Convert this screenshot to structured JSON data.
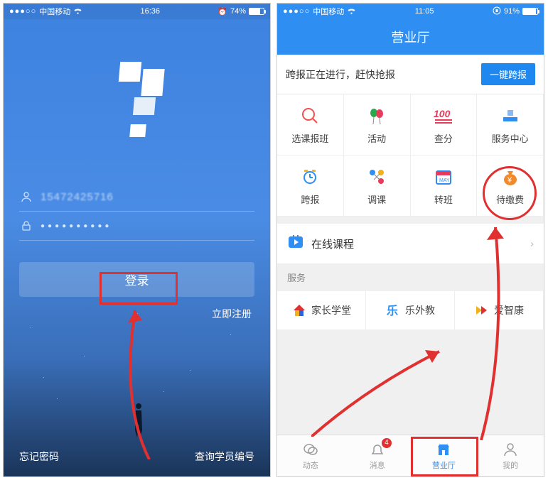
{
  "left": {
    "statusbar": {
      "signal": "●●●○○",
      "carrier": "中国移动",
      "time": "16:36",
      "battery_alarm": "⏰",
      "battery_pct": "74%"
    },
    "username_value": "15472425716",
    "password_masked": "●●●●●●●●●●",
    "login_label": "登录",
    "register_label": "立即注册",
    "forgot_label": "忘记密码",
    "lookup_label": "查询学员编号"
  },
  "right": {
    "statusbar": {
      "signal": "●●●○○",
      "carrier": "中国移动",
      "time": "11:05",
      "lock": true,
      "battery_pct": "91%"
    },
    "header_title": "营业厅",
    "notice_text": "跨报正在进行，赶快抢报",
    "notice_btn": "一键跨报",
    "grid": [
      {
        "label": "选课报班",
        "icon": "#f05050",
        "shape": "magnify"
      },
      {
        "label": "活动",
        "icon": "#2aa84a",
        "shape": "balloons"
      },
      {
        "label": "查分",
        "icon": "#e83a5a",
        "shape": "score100"
      },
      {
        "label": "服务中心",
        "icon": "#2e8ef2",
        "shape": "desk"
      },
      {
        "label": "跨报",
        "icon": "#2e8ef2",
        "shape": "clock"
      },
      {
        "label": "调课",
        "icon": "#f09a2a",
        "shape": "swap"
      },
      {
        "label": "转班",
        "icon": "#2e8ef2",
        "shape": "calendar"
      },
      {
        "label": "待缴费",
        "icon": "#f08a2a",
        "shape": "moneybag"
      }
    ],
    "online_course": "在线课程",
    "service_header": "服务",
    "services": [
      {
        "label": "家长学堂",
        "color1": "#e03030",
        "color2": "#2a62e0"
      },
      {
        "label": "乐外教",
        "color1": "#2e8ef2"
      },
      {
        "label": "爱智康",
        "color1": "#f0b020"
      }
    ],
    "tabs": [
      {
        "label": "动态",
        "icon": "chat"
      },
      {
        "label": "消息",
        "icon": "bell",
        "badge": "4"
      },
      {
        "label": "营业厅",
        "icon": "shop",
        "active": true
      },
      {
        "label": "我的",
        "icon": "person"
      }
    ]
  }
}
